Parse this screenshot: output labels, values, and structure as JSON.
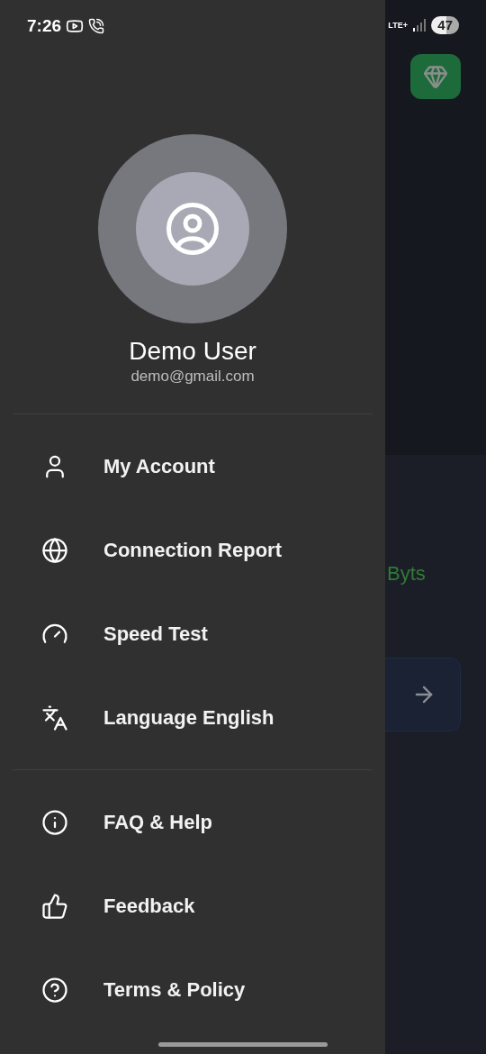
{
  "status_bar": {
    "time": "7:26",
    "network": "LTE+",
    "battery": "47"
  },
  "background": {
    "stat": "Byts"
  },
  "drawer": {
    "profile": {
      "name": "Demo User",
      "email": "demo@gmail.com"
    },
    "groups": [
      {
        "items": [
          {
            "label": "My Account"
          },
          {
            "label": "Connection Report"
          },
          {
            "label": "Speed Test"
          },
          {
            "label": "Language English"
          }
        ]
      },
      {
        "items": [
          {
            "label": "FAQ & Help"
          },
          {
            "label": "Feedback"
          },
          {
            "label": "Terms & Policy"
          }
        ]
      }
    ]
  }
}
